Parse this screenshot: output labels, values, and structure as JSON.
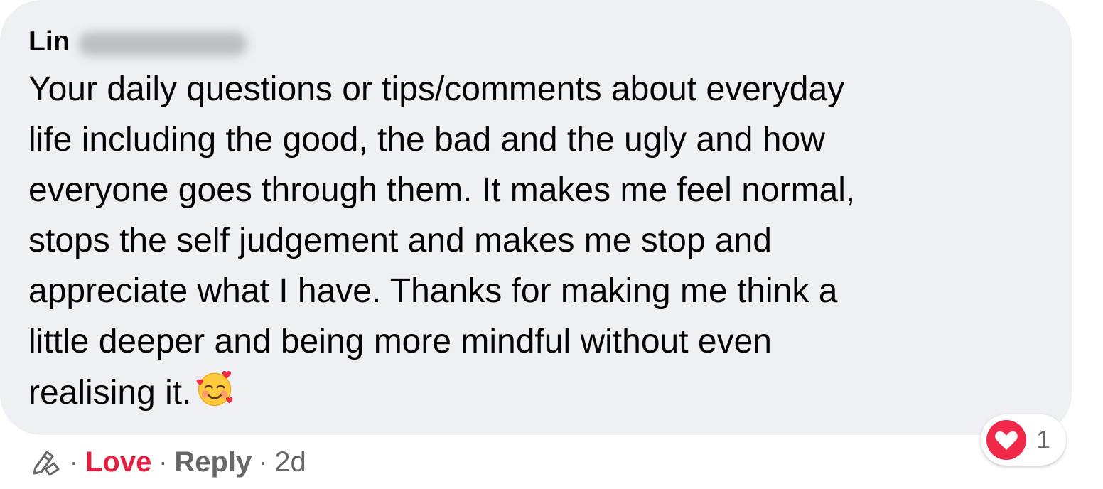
{
  "comment": {
    "author_first_name": "Lin",
    "author_surname_redacted": true,
    "text_lines": [
      "Your daily questions or tips/comments about everyday",
      "life including the good, the bad and the ugly and how",
      "everyone goes through them. It makes me feel normal,",
      "stops the self judgement and makes me stop and",
      "appreciate what I have. Thanks for making me think a",
      "little deeper and being more mindful without even",
      "realising it."
    ],
    "emoji": "smiling-face-with-hearts-icon"
  },
  "reactions": {
    "icon": "love-heart-icon",
    "count": "1"
  },
  "actions": {
    "separator": "·",
    "love_label": "Love",
    "reply_label": "Reply",
    "timestamp": "2d"
  },
  "colors": {
    "bubble_bg": "#eff0f3",
    "love_red": "#e41e3f",
    "secondary_text": "#65676b",
    "primary_text": "#050505"
  }
}
